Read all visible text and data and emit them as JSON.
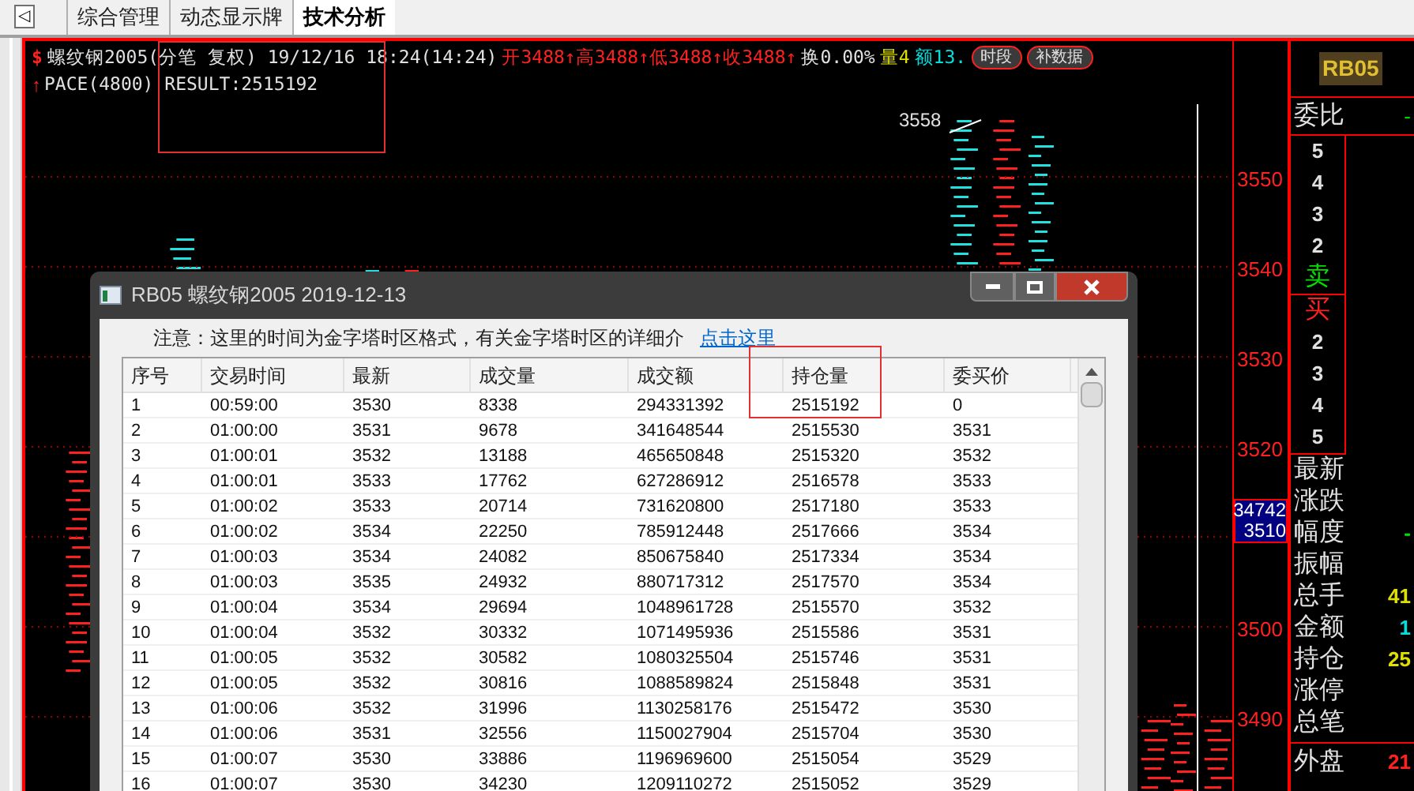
{
  "tabs": {
    "scroll_button": "◁",
    "items": [
      {
        "label": "综合管理",
        "selected": false
      },
      {
        "label": "动态显示牌",
        "selected": false
      },
      {
        "label": "技术分析",
        "selected": true
      }
    ]
  },
  "chart": {
    "header": [
      {
        "text": "$",
        "color": "#ff2020"
      },
      {
        "text": "螺纹钢2005(分笔 复权) 19/12/16 18:24(14:24)",
        "color": "#e0e0e0"
      },
      {
        "text": "开3488↑高3488↑低3488↑收3488↑",
        "color": "#ff2020"
      },
      {
        "text": "换0.00%",
        "color": "#e0e0e0"
      },
      {
        "text": "量4",
        "color": "#e0e000"
      },
      {
        "text": "额13.",
        "color": "#00e0e0"
      }
    ],
    "header_buttons": [
      "时段",
      "补数据"
    ],
    "indicator": {
      "arrow": "↑",
      "text": "PACE(4800) RESULT:2515192"
    },
    "peak_label": "3558",
    "price_axis": [
      "3550",
      "3540",
      "3530",
      "3520",
      "3500",
      "3490"
    ],
    "cursor_box": [
      "34742",
      "3510"
    ]
  },
  "order_book": {
    "title": "委比",
    "value": "-",
    "sell_levels": [
      "5",
      "4",
      "3",
      "2"
    ],
    "sell_label": "卖",
    "buy_label": "买",
    "buy_levels": [
      "2",
      "3",
      "4",
      "5"
    ]
  },
  "stats": [
    {
      "label": "最新"
    },
    {
      "label": "涨跌"
    },
    {
      "label": "幅度",
      "value": "-",
      "color": "#00e000"
    },
    {
      "label": "振幅"
    },
    {
      "label": "总手",
      "value": "41",
      "color": "#e0e000"
    },
    {
      "label": "金额",
      "value": "1",
      "color": "#00e0e0"
    },
    {
      "label": "持仓",
      "value": "25",
      "color": "#e0e000"
    },
    {
      "label": "涨停"
    },
    {
      "label": "总笔"
    }
  ],
  "outer": {
    "label": "外盘",
    "value": "21"
  },
  "product_badge": "RB05",
  "dialog": {
    "title": "RB05 螺纹钢2005 2019-12-13",
    "notice": "注意：这里的时间为金字塔时区格式，有关金字塔时区的详细介",
    "link": "点击这里",
    "table": {
      "columns": [
        "序号",
        "交易时间",
        "最新",
        "成交量",
        "成交额",
        "持仓量",
        "委买价"
      ],
      "rows": [
        [
          "1",
          "00:59:00",
          "3530",
          "8338",
          "294331392",
          "2515192",
          "0"
        ],
        [
          "2",
          "01:00:00",
          "3531",
          "9678",
          "341648544",
          "2515530",
          "3531"
        ],
        [
          "3",
          "01:00:01",
          "3532",
          "13188",
          "465650848",
          "2515320",
          "3532"
        ],
        [
          "4",
          "01:00:01",
          "3533",
          "17762",
          "627286912",
          "2516578",
          "3533"
        ],
        [
          "5",
          "01:00:02",
          "3533",
          "20714",
          "731620800",
          "2517180",
          "3533"
        ],
        [
          "6",
          "01:00:02",
          "3534",
          "22250",
          "785912448",
          "2517666",
          "3534"
        ],
        [
          "7",
          "01:00:03",
          "3534",
          "24082",
          "850675840",
          "2517334",
          "3534"
        ],
        [
          "8",
          "01:00:03",
          "3535",
          "24932",
          "880717312",
          "2517570",
          "3534"
        ],
        [
          "9",
          "01:00:04",
          "3534",
          "29694",
          "1048961728",
          "2515570",
          "3532"
        ],
        [
          "10",
          "01:00:04",
          "3532",
          "30332",
          "1071495936",
          "2515586",
          "3531"
        ],
        [
          "11",
          "01:00:05",
          "3532",
          "30582",
          "1080325504",
          "2515746",
          "3531"
        ],
        [
          "12",
          "01:00:05",
          "3532",
          "30816",
          "1088589824",
          "2515848",
          "3531"
        ],
        [
          "13",
          "01:00:06",
          "3532",
          "31996",
          "1130258176",
          "2515472",
          "3530"
        ],
        [
          "14",
          "01:00:06",
          "3531",
          "32556",
          "1150027904",
          "2515704",
          "3530"
        ],
        [
          "15",
          "01:00:07",
          "3530",
          "33886",
          "1196969600",
          "2515054",
          "3529"
        ],
        [
          "16",
          "01:00:07",
          "3530",
          "34230",
          "1209110272",
          "2515052",
          "3529"
        ]
      ]
    }
  }
}
